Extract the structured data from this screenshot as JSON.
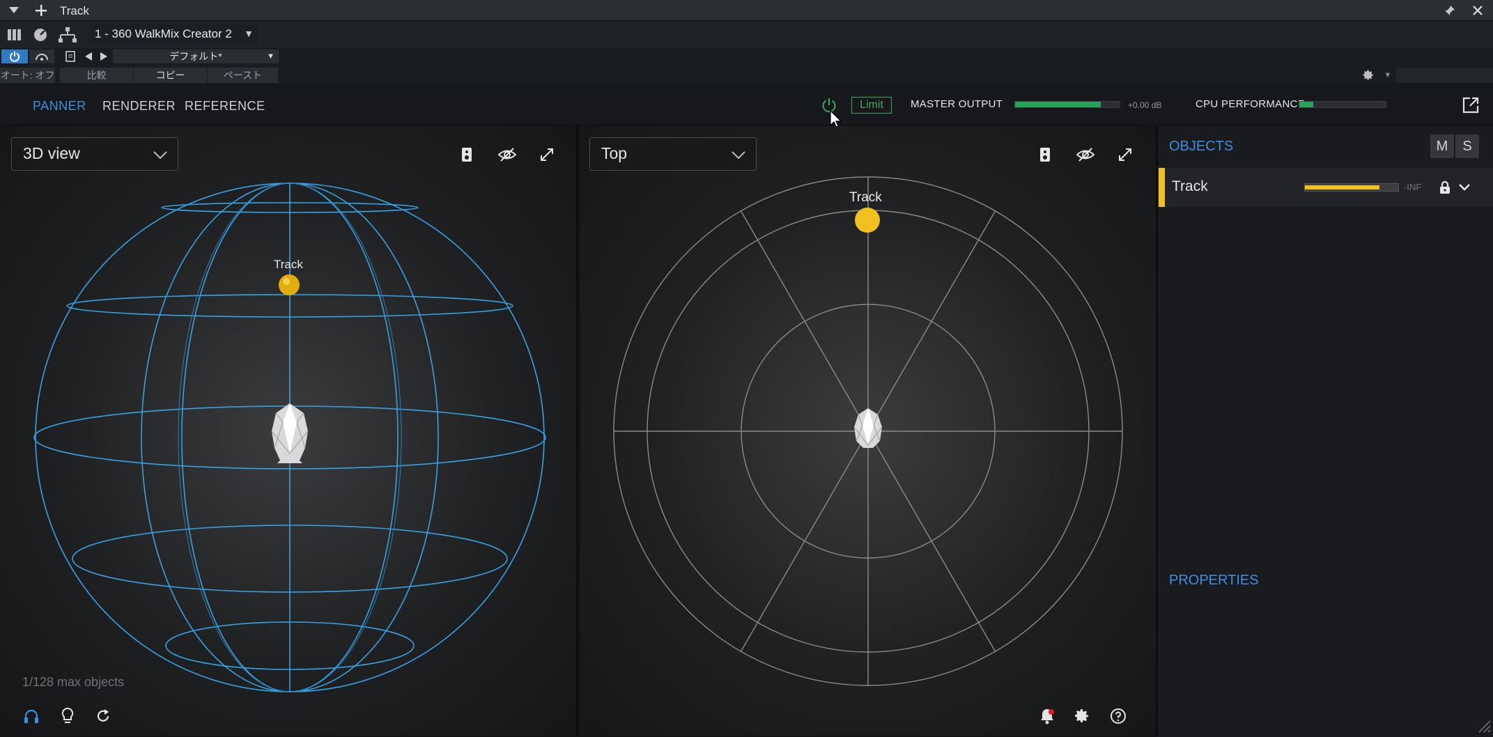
{
  "host": {
    "window_title": "Track",
    "plugin_preset": "1 - 360 WalkMix Creator 2",
    "preset_name": "デフォルト*",
    "auto_label": "オート: オフ",
    "compare_label": "比較",
    "copy_label": "コピー",
    "paste_label": "ペースト"
  },
  "header": {
    "tabs": [
      {
        "label": "PANNER",
        "active": true
      },
      {
        "label": "RENDERER",
        "active": false
      },
      {
        "label": "REFERENCE",
        "active": false
      }
    ],
    "limit_label": "Limit",
    "master_output_label": "MASTER OUTPUT",
    "master_output_db": "+0.00 dB",
    "master_output_level": 0.82,
    "cpu_label": "CPU PERFORMANCE",
    "cpu_level": 0.16,
    "colors": {
      "accent": "#3d8fe0",
      "meter": "#27a35a",
      "object": "#f2c01f",
      "limit": "#3fa85c"
    }
  },
  "left_view": {
    "selected_view": "3D view",
    "object_label": "Track",
    "max_objects_text": "1/128 max objects",
    "icons": [
      "speaker-icon",
      "eye-off-icon",
      "expand-icon",
      "headphones-icon",
      "lightbulb-icon",
      "refresh-icon"
    ]
  },
  "right_view": {
    "selected_view": "Top",
    "object_label": "Track",
    "icons": [
      "speaker-icon",
      "eye-off-icon",
      "expand-icon",
      "notification-bell-icon",
      "gear-icon",
      "help-icon"
    ]
  },
  "sidebar": {
    "objects_title": "OBJECTS",
    "mute_label": "M",
    "solo_label": "S",
    "objects": [
      {
        "name": "Track",
        "level_text": "-INF",
        "level": 0.8
      }
    ],
    "properties_title": "PROPERTIES"
  }
}
